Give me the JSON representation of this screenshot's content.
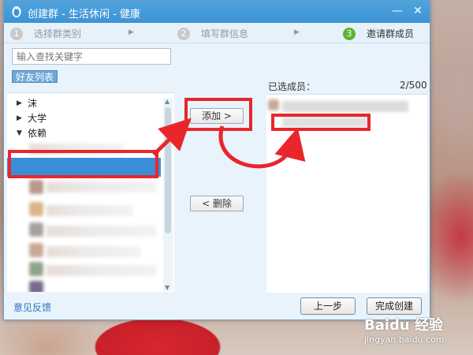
{
  "window": {
    "title": "创建群 - 生活休闲 - 健康",
    "minimize": "—",
    "close": "✕"
  },
  "steps": [
    {
      "num": "1",
      "label": "选择群类别"
    },
    {
      "num": "2",
      "label": "填写群信息"
    },
    {
      "num": "3",
      "label": "邀请群成员"
    }
  ],
  "step_sep": "▶",
  "search": {
    "placeholder": "输入查找关键字"
  },
  "friend_tab": "好友列表",
  "groups": [
    {
      "label": "沫",
      "expanded": false
    },
    {
      "label": "大学",
      "expanded": false
    },
    {
      "label": "依赖",
      "expanded": true
    }
  ],
  "buttons": {
    "add": "添加 >",
    "remove": "< 删除",
    "prev": "上一步",
    "finish": "完成创建"
  },
  "selected": {
    "label": "已选成员：",
    "count": "2/500"
  },
  "feedback": "意见反馈",
  "watermark": {
    "brand": "Baidu 经验",
    "url": "jingyan.baidu.com"
  },
  "colors": {
    "accent": "#3d94d6",
    "annotation": "#e8262b",
    "selected_row": "#3b8fd9"
  }
}
